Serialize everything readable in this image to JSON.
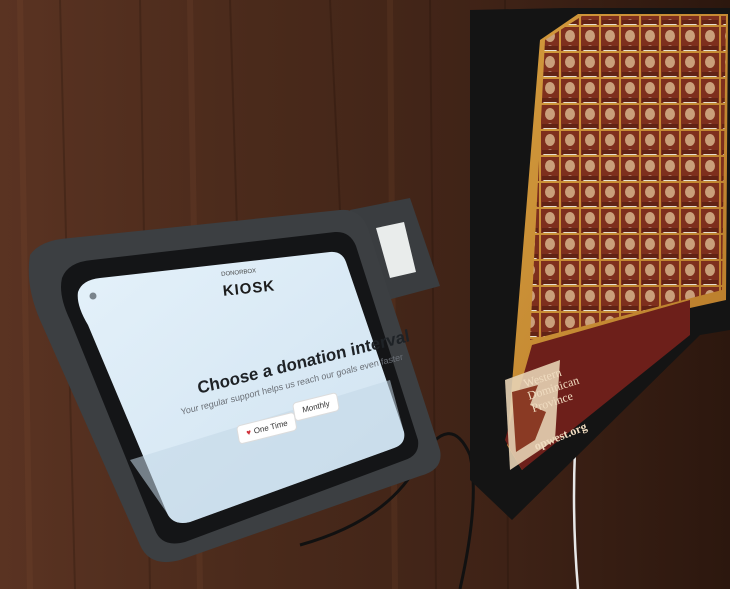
{
  "kiosk": {
    "brand_small": "DONORBOX",
    "logo": "KIOSK",
    "headline": "Choose a donation interval",
    "subtitle": "Your regular support helps us reach our goals even faster",
    "buttons": [
      {
        "label": "One Time",
        "icon": "heart-icon",
        "selected": true
      },
      {
        "label": "Monthly",
        "icon": null,
        "selected": false
      }
    ],
    "accent_color": "#d0323a",
    "screen_color": "#dcecf7"
  },
  "poster": {
    "title_lines": [
      "Western",
      "Dominican",
      "Province"
    ],
    "url": "opwest.org"
  }
}
